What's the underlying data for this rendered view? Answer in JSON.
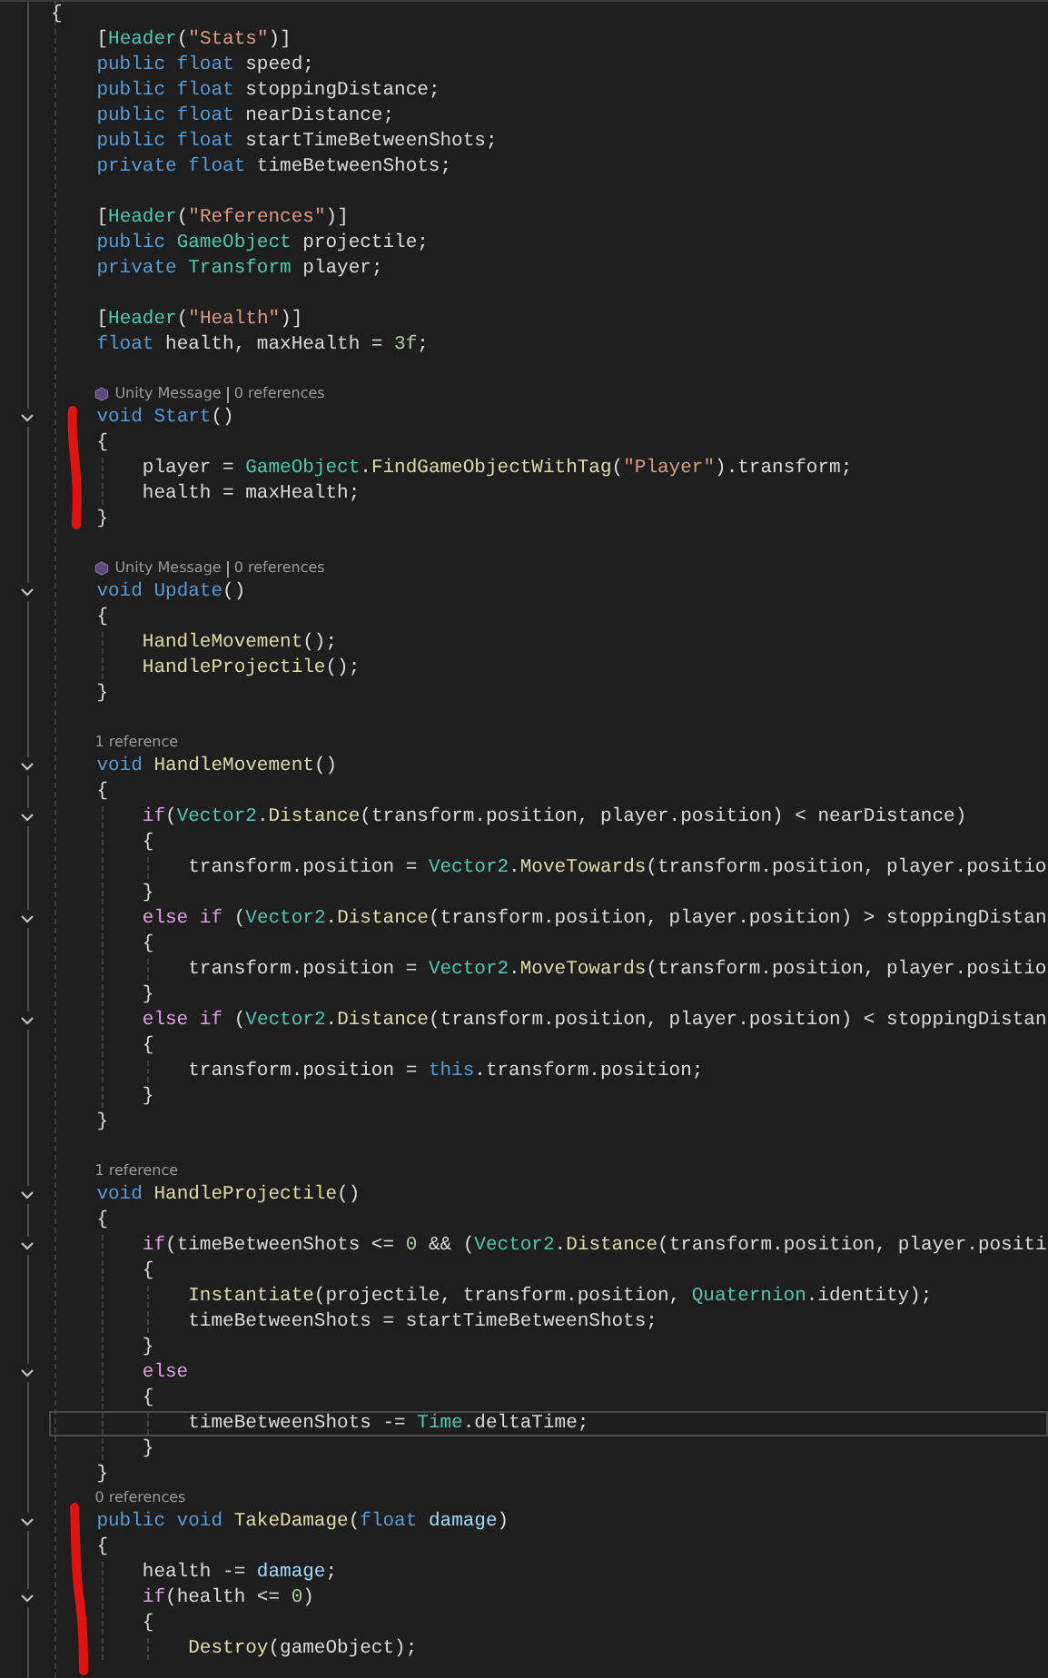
{
  "lines": [
    {
      "kind": "code",
      "fold": false,
      "current": false,
      "tokens": [
        {
          "kind": "plain",
          "text": "{"
        }
      ],
      "children": [
        {
          "kind": "code",
          "fold": false,
          "current": false,
          "tokens": [
            {
              "kind": "plain",
              "text": "["
            },
            {
              "kind": "type",
              "text": "Header"
            },
            {
              "kind": "plain",
              "text": "("
            },
            {
              "kind": "str",
              "text": "\"Stats\""
            },
            {
              "kind": "plain",
              "text": ")]"
            }
          ]
        },
        {
          "kind": "code",
          "fold": false,
          "current": false,
          "tokens": [
            {
              "kind": "kw",
              "text": "public float "
            },
            {
              "kind": "plain",
              "text": "speed;"
            }
          ]
        },
        {
          "kind": "code",
          "fold": false,
          "current": false,
          "tokens": [
            {
              "kind": "kw",
              "text": "public float "
            },
            {
              "kind": "plain",
              "text": "stoppingDistance;"
            }
          ]
        },
        {
          "kind": "code",
          "fold": false,
          "current": false,
          "tokens": [
            {
              "kind": "kw",
              "text": "public float "
            },
            {
              "kind": "plain",
              "text": "nearDistance;"
            }
          ]
        },
        {
          "kind": "code",
          "fold": false,
          "current": false,
          "tokens": [
            {
              "kind": "kw",
              "text": "public float "
            },
            {
              "kind": "plain",
              "text": "startTimeBetweenShots;"
            }
          ]
        },
        {
          "kind": "code",
          "fold": false,
          "current": false,
          "tokens": [
            {
              "kind": "kw",
              "text": "private float "
            },
            {
              "kind": "plain",
              "text": "timeBetweenShots;"
            }
          ]
        },
        {
          "kind": "blank"
        },
        {
          "kind": "code",
          "fold": false,
          "current": false,
          "tokens": [
            {
              "kind": "plain",
              "text": "["
            },
            {
              "kind": "type",
              "text": "Header"
            },
            {
              "kind": "plain",
              "text": "("
            },
            {
              "kind": "str",
              "text": "\"References\""
            },
            {
              "kind": "plain",
              "text": ")]"
            }
          ]
        },
        {
          "kind": "code",
          "fold": false,
          "current": false,
          "tokens": [
            {
              "kind": "kw",
              "text": "public "
            },
            {
              "kind": "type",
              "text": "GameObject"
            },
            {
              "kind": "plain",
              "text": " projectile;"
            }
          ]
        },
        {
          "kind": "code",
          "fold": false,
          "current": false,
          "tokens": [
            {
              "kind": "kw",
              "text": "private "
            },
            {
              "kind": "type",
              "text": "Transform"
            },
            {
              "kind": "plain",
              "text": " player;"
            }
          ]
        },
        {
          "kind": "blank"
        },
        {
          "kind": "code",
          "fold": false,
          "current": false,
          "tokens": [
            {
              "kind": "plain",
              "text": "["
            },
            {
              "kind": "type",
              "text": "Header"
            },
            {
              "kind": "plain",
              "text": "("
            },
            {
              "kind": "str",
              "text": "\"Health\""
            },
            {
              "kind": "plain",
              "text": ")]"
            }
          ]
        },
        {
          "kind": "code",
          "fold": false,
          "current": false,
          "tokens": [
            {
              "kind": "kw",
              "text": "float "
            },
            {
              "kind": "plain",
              "text": "health, maxHealth = "
            },
            {
              "kind": "num",
              "text": "3f"
            },
            {
              "kind": "plain",
              "text": ";"
            }
          ]
        },
        {
          "kind": "blank"
        },
        {
          "kind": "lens",
          "message": "Unity Message",
          "refs": "0 references"
        },
        {
          "kind": "code",
          "fold": true,
          "current": false,
          "tokens": [
            {
              "kind": "kw",
              "text": "void "
            },
            {
              "kind": "kw",
              "text": "Start"
            },
            {
              "kind": "plain",
              "text": "()"
            }
          ]
        },
        {
          "kind": "code",
          "fold": false,
          "current": false,
          "tokens": [
            {
              "kind": "plain",
              "text": "{"
            }
          ],
          "children": [
            {
              "kind": "code",
              "fold": false,
              "current": false,
              "tokens": [
                {
                  "kind": "plain",
                  "text": "player = "
                },
                {
                  "kind": "type",
                  "text": "GameObject"
                },
                {
                  "kind": "plain",
                  "text": "."
                },
                {
                  "kind": "fn",
                  "text": "FindGameObjectWithTag"
                },
                {
                  "kind": "plain",
                  "text": "("
                },
                {
                  "kind": "str",
                  "text": "\"Player\""
                },
                {
                  "kind": "plain",
                  "text": ").transform;"
                }
              ]
            },
            {
              "kind": "code",
              "fold": false,
              "current": false,
              "tokens": [
                {
                  "kind": "plain",
                  "text": "health = maxHealth;"
                }
              ]
            }
          ]
        },
        {
          "kind": "code",
          "fold": false,
          "current": false,
          "tokens": [
            {
              "kind": "plain",
              "text": "}"
            }
          ]
        },
        {
          "kind": "blank"
        },
        {
          "kind": "lens",
          "message": "Unity Message",
          "refs": "0 references"
        },
        {
          "kind": "code",
          "fold": true,
          "current": false,
          "tokens": [
            {
              "kind": "kw",
              "text": "void "
            },
            {
              "kind": "kw",
              "text": "Update"
            },
            {
              "kind": "plain",
              "text": "()"
            }
          ]
        },
        {
          "kind": "code",
          "fold": false,
          "current": false,
          "tokens": [
            {
              "kind": "plain",
              "text": "{"
            }
          ],
          "children": [
            {
              "kind": "code",
              "fold": false,
              "current": false,
              "tokens": [
                {
                  "kind": "fn",
                  "text": "HandleMovement"
                },
                {
                  "kind": "plain",
                  "text": "();"
                }
              ]
            },
            {
              "kind": "code",
              "fold": false,
              "current": false,
              "tokens": [
                {
                  "kind": "fn",
                  "text": "HandleProjectile"
                },
                {
                  "kind": "plain",
                  "text": "();"
                }
              ]
            }
          ]
        },
        {
          "kind": "code",
          "fold": false,
          "current": false,
          "tokens": [
            {
              "kind": "plain",
              "text": "}"
            }
          ]
        },
        {
          "kind": "blank"
        },
        {
          "kind": "lens",
          "refs": "1 reference"
        },
        {
          "kind": "code",
          "fold": true,
          "current": false,
          "tokens": [
            {
              "kind": "kw",
              "text": "void "
            },
            {
              "kind": "fn",
              "text": "HandleMovement"
            },
            {
              "kind": "plain",
              "text": "()"
            }
          ]
        },
        {
          "kind": "code",
          "fold": false,
          "current": false,
          "tokens": [
            {
              "kind": "plain",
              "text": "{"
            }
          ],
          "children": [
            {
              "kind": "code",
              "fold": true,
              "current": false,
              "tokens": [
                {
                  "kind": "ctl",
                  "text": "if"
                },
                {
                  "kind": "plain",
                  "text": "("
                },
                {
                  "kind": "type",
                  "text": "Vector2"
                },
                {
                  "kind": "plain",
                  "text": "."
                },
                {
                  "kind": "fn",
                  "text": "Distance"
                },
                {
                  "kind": "plain",
                  "text": "(transform.position, player.position) < nearDistance)"
                }
              ]
            },
            {
              "kind": "code",
              "fold": false,
              "current": false,
              "tokens": [
                {
                  "kind": "plain",
                  "text": "{"
                }
              ],
              "children": [
                {
                  "kind": "code",
                  "fold": false,
                  "current": false,
                  "tokens": [
                    {
                      "kind": "plain",
                      "text": "transform.position = "
                    },
                    {
                      "kind": "type",
                      "text": "Vector2"
                    },
                    {
                      "kind": "plain",
                      "text": "."
                    },
                    {
                      "kind": "fn",
                      "text": "MoveTowards"
                    },
                    {
                      "kind": "plain",
                      "text": "(transform.position, player.positio"
                    }
                  ]
                }
              ]
            },
            {
              "kind": "code",
              "fold": false,
              "current": false,
              "tokens": [
                {
                  "kind": "plain",
                  "text": "}"
                }
              ]
            },
            {
              "kind": "code",
              "fold": true,
              "current": false,
              "tokens": [
                {
                  "kind": "ctl",
                  "text": "else if "
                },
                {
                  "kind": "plain",
                  "text": "("
                },
                {
                  "kind": "type",
                  "text": "Vector2"
                },
                {
                  "kind": "plain",
                  "text": "."
                },
                {
                  "kind": "fn",
                  "text": "Distance"
                },
                {
                  "kind": "plain",
                  "text": "(transform.position, player.position) > stoppingDistan"
                }
              ]
            },
            {
              "kind": "code",
              "fold": false,
              "current": false,
              "tokens": [
                {
                  "kind": "plain",
                  "text": "{"
                }
              ],
              "children": [
                {
                  "kind": "code",
                  "fold": false,
                  "current": false,
                  "tokens": [
                    {
                      "kind": "plain",
                      "text": "transform.position = "
                    },
                    {
                      "kind": "type",
                      "text": "Vector2"
                    },
                    {
                      "kind": "plain",
                      "text": "."
                    },
                    {
                      "kind": "fn",
                      "text": "MoveTowards"
                    },
                    {
                      "kind": "plain",
                      "text": "(transform.position, player.positio"
                    }
                  ]
                }
              ]
            },
            {
              "kind": "code",
              "fold": false,
              "current": false,
              "tokens": [
                {
                  "kind": "plain",
                  "text": "}"
                }
              ]
            },
            {
              "kind": "code",
              "fold": true,
              "current": false,
              "tokens": [
                {
                  "kind": "ctl",
                  "text": "else if "
                },
                {
                  "kind": "plain",
                  "text": "("
                },
                {
                  "kind": "type",
                  "text": "Vector2"
                },
                {
                  "kind": "plain",
                  "text": "."
                },
                {
                  "kind": "fn",
                  "text": "Distance"
                },
                {
                  "kind": "plain",
                  "text": "(transform.position, player.position) < stoppingDistan"
                }
              ]
            },
            {
              "kind": "code",
              "fold": false,
              "current": false,
              "tokens": [
                {
                  "kind": "plain",
                  "text": "{"
                }
              ],
              "children": [
                {
                  "kind": "code",
                  "fold": false,
                  "current": false,
                  "tokens": [
                    {
                      "kind": "plain",
                      "text": "transform.position = "
                    },
                    {
                      "kind": "kw",
                      "text": "this"
                    },
                    {
                      "kind": "plain",
                      "text": ".transform.position;"
                    }
                  ]
                }
              ]
            },
            {
              "kind": "code",
              "fold": false,
              "current": false,
              "tokens": [
                {
                  "kind": "plain",
                  "text": "}"
                }
              ]
            }
          ]
        },
        {
          "kind": "code",
          "fold": false,
          "current": false,
          "tokens": [
            {
              "kind": "plain",
              "text": "}"
            }
          ]
        },
        {
          "kind": "blank"
        },
        {
          "kind": "lens",
          "refs": "1 reference"
        },
        {
          "kind": "code",
          "fold": true,
          "current": false,
          "tokens": [
            {
              "kind": "kw",
              "text": "void "
            },
            {
              "kind": "fn",
              "text": "HandleProjectile"
            },
            {
              "kind": "plain",
              "text": "()"
            }
          ]
        },
        {
          "kind": "code",
          "fold": false,
          "current": false,
          "tokens": [
            {
              "kind": "plain",
              "text": "{"
            }
          ],
          "children": [
            {
              "kind": "code",
              "fold": true,
              "current": false,
              "tokens": [
                {
                  "kind": "ctl",
                  "text": "if"
                },
                {
                  "kind": "plain",
                  "text": "(timeBetweenShots <= "
                },
                {
                  "kind": "num",
                  "text": "0"
                },
                {
                  "kind": "plain",
                  "text": " && ("
                },
                {
                  "kind": "type",
                  "text": "Vector2"
                },
                {
                  "kind": "plain",
                  "text": "."
                },
                {
                  "kind": "fn",
                  "text": "Distance"
                },
                {
                  "kind": "plain",
                  "text": "(transform.position, player.positi"
                }
              ]
            },
            {
              "kind": "code",
              "fold": false,
              "current": false,
              "tokens": [
                {
                  "kind": "plain",
                  "text": "{"
                }
              ],
              "children": [
                {
                  "kind": "code",
                  "fold": false,
                  "current": false,
                  "tokens": [
                    {
                      "kind": "fn",
                      "text": "Instantiate"
                    },
                    {
                      "kind": "plain",
                      "text": "(projectile, transform.position, "
                    },
                    {
                      "kind": "type",
                      "text": "Quaternion"
                    },
                    {
                      "kind": "plain",
                      "text": ".identity);"
                    }
                  ]
                },
                {
                  "kind": "code",
                  "fold": false,
                  "current": false,
                  "tokens": [
                    {
                      "kind": "plain",
                      "text": "timeBetweenShots = startTimeBetweenShots;"
                    }
                  ]
                }
              ]
            },
            {
              "kind": "code",
              "fold": false,
              "current": false,
              "tokens": [
                {
                  "kind": "plain",
                  "text": "}"
                }
              ]
            },
            {
              "kind": "code",
              "fold": true,
              "current": false,
              "tokens": [
                {
                  "kind": "ctl",
                  "text": "else"
                }
              ]
            },
            {
              "kind": "code",
              "fold": false,
              "current": false,
              "tokens": [
                {
                  "kind": "plain",
                  "text": "{"
                }
              ],
              "children": [
                {
                  "kind": "code",
                  "fold": false,
                  "current": true,
                  "tokens": [
                    {
                      "kind": "plain",
                      "text": "timeBetweenShots -= "
                    },
                    {
                      "kind": "type",
                      "text": "Time"
                    },
                    {
                      "kind": "plain",
                      "text": ".deltaTime;"
                    }
                  ]
                }
              ]
            },
            {
              "kind": "code",
              "fold": false,
              "current": false,
              "tokens": [
                {
                  "kind": "plain",
                  "text": "}"
                }
              ]
            }
          ]
        },
        {
          "kind": "code",
          "fold": false,
          "current": false,
          "tokens": [
            {
              "kind": "plain",
              "text": "}"
            }
          ]
        },
        {
          "kind": "lens",
          "refs": "0 references"
        },
        {
          "kind": "code",
          "fold": true,
          "current": false,
          "tokens": [
            {
              "kind": "kw",
              "text": "public void "
            },
            {
              "kind": "fn",
              "text": "TakeDamage"
            },
            {
              "kind": "plain",
              "text": "("
            },
            {
              "kind": "kw",
              "text": "float "
            },
            {
              "kind": "param",
              "text": "damage"
            },
            {
              "kind": "plain",
              "text": ")"
            }
          ]
        },
        {
          "kind": "code",
          "fold": false,
          "current": false,
          "tokens": [
            {
              "kind": "plain",
              "text": "{"
            }
          ],
          "children": [
            {
              "kind": "code",
              "fold": false,
              "current": false,
              "tokens": [
                {
                  "kind": "plain",
                  "text": "health -= "
                },
                {
                  "kind": "param",
                  "text": "damage"
                },
                {
                  "kind": "plain",
                  "text": ";"
                }
              ]
            },
            {
              "kind": "code",
              "fold": true,
              "current": false,
              "tokens": [
                {
                  "kind": "ctl",
                  "text": "if"
                },
                {
                  "kind": "plain",
                  "text": "(health <= "
                },
                {
                  "kind": "num",
                  "text": "0"
                },
                {
                  "kind": "plain",
                  "text": ")"
                }
              ]
            },
            {
              "kind": "code",
              "fold": false,
              "current": false,
              "tokens": [
                {
                  "kind": "plain",
                  "text": "{"
                }
              ],
              "children": [
                {
                  "kind": "code",
                  "fold": false,
                  "current": false,
                  "tokens": [
                    {
                      "kind": "fn",
                      "text": "Destroy"
                    },
                    {
                      "kind": "plain",
                      "text": "(gameObject);"
                    }
                  ]
                }
              ]
            }
          ]
        }
      ]
    }
  ]
}
